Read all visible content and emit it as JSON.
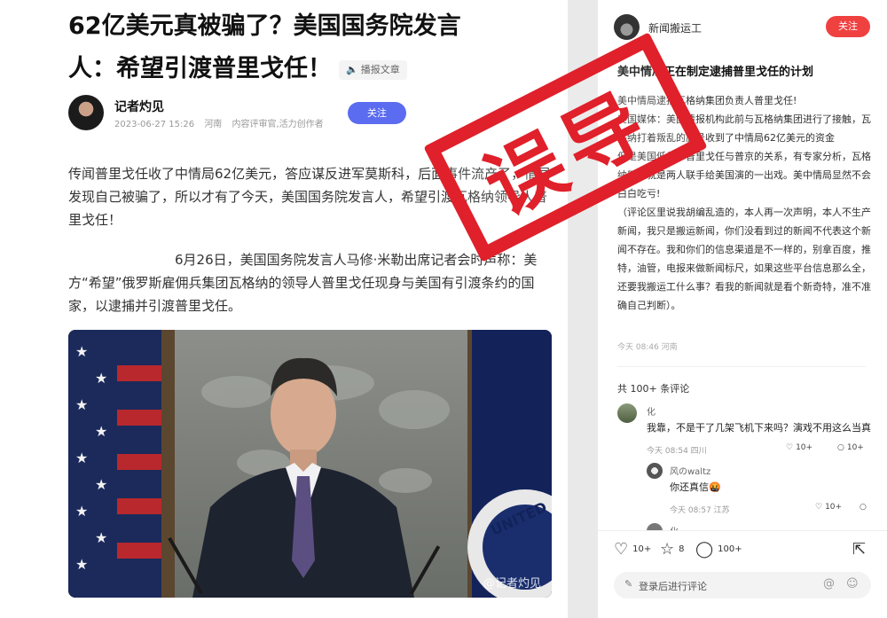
{
  "article": {
    "title_line1": "62亿美元真被骗了？美国国务院发言",
    "title_line2": "人：希望引渡普里戈任！",
    "listen_label": "播报文章",
    "author_name": "记者灼见",
    "date": "2023-06-27 15:26",
    "location": "河南",
    "author_role": "内容评审官,活力创作者",
    "follow_label": "关注",
    "para1": "传闻普里戈任收了中情局62亿美元，答应谋反进军莫斯科，后面事件流产了，情局发现自己被骗了，所以才有了今天，美国国务院发言人，希望引渡瓦格纳领导人普里戈任！",
    "para2": "6月26日，美国国务院发言人马修·米勒出席记者会时声称：美方“希望”俄罗斯雇佣兵集团瓦格纳的领导人普里戈任现身与美国有引渡条约的国家，以逮捕并引渡普里戈任。",
    "image_watermark": "@记者灼见",
    "flag_text": "UNITED"
  },
  "sidebar": {
    "username": "新闻搬运工",
    "follow_label": "关注",
    "post_title": "美中情局正在制定逮捕普里戈任的计划",
    "body": [
      "美中情局逮捕瓦格纳集团负责人普里戈任!",
      "美国媒体：美国情报机构此前与瓦格纳集团进行了接触，瓦格纳打着叛乱的旗号收到了中情局62亿美元的资金",
      "但是美国低估了普里戈任与普京的关系，有专家分析，瓦格纳叛乱就是两人联手给美国演的一出戏。美中情局显然不会白白吃亏!",
      "（评论区里说我胡编乱造的，本人再一次声明，本人不生产新闻，我只是搬运新闻，你们没看到过的新闻不代表这个新闻不存在。我和你们的信息渠道是不一样的，别拿百度，推特，油管，电报来做新闻标尺，如果这些平台信息那么全，还要我搬运工什么事？看我的新闻就是看个新奇特，准不准确自己判断）。"
    ],
    "post_time": "今天 08:46 河南",
    "comment_count": "共 100+ 条评论",
    "comments": [
      {
        "name": "化",
        "text": "我靠，不是干了几架飞机下来吗？演戏不用这么当真",
        "meta": "今天 08:54 四川",
        "likes": "10+",
        "replies": "10+"
      },
      {
        "name": "风のwaltz",
        "text": "你还真信🤬",
        "meta": "今天 08:57 江苏",
        "likes": "10+",
        "replies": ""
      },
      {
        "name": "化",
        "text": "",
        "meta": "",
        "likes": "",
        "replies": ""
      }
    ],
    "actions": {
      "likes": "10+",
      "favorites": "8",
      "comments": "100+"
    },
    "input_placeholder": "登录后进行评论"
  },
  "stamp_text": "误导",
  "colors": {
    "stamp_red": "#e0202a",
    "follow_blue": "#5b6cf0",
    "follow_red": "#f04141"
  }
}
